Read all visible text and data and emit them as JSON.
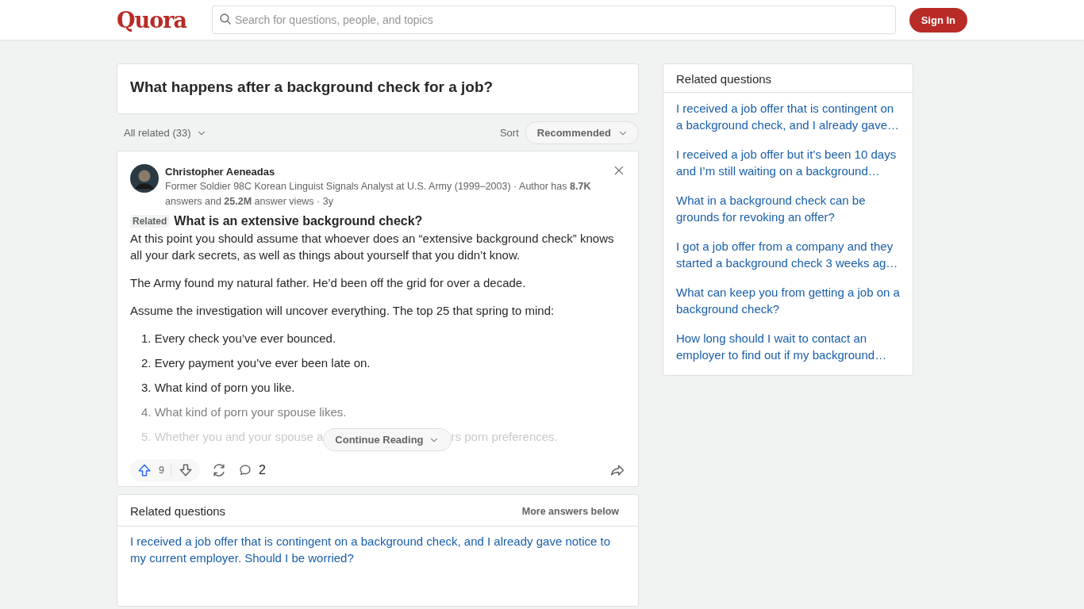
{
  "header": {
    "logo": "Quora",
    "search": {
      "placeholder": "Search for questions, people, and topics"
    },
    "sign_in": "Sign In"
  },
  "question": {
    "title": "What happens after a background check for a job?"
  },
  "filter": {
    "all_related": "All related (33)",
    "sort_label": "Sort",
    "sort_value": "Recommended"
  },
  "answer": {
    "author": "Christopher Aeneadas",
    "credential": "Former Soldier 98C Korean Linguist Signals Analyst at U.S. Army (1999–2003) · Author has **8.7K** answers and **25.2M** answer views · 3y",
    "related_tag": "Related",
    "related_question": "What is an extensive background check?",
    "paragraphs": [
      "At this point you should assume that whoever does an “extensive background check” knows all your dark secrets, as well as things about yourself that you didn’t know.",
      "The Army found my natural father. He’d been off the grid for over a decade.",
      "Assume the investigation will uncover everything. The top 25 that spring to mind:"
    ],
    "list": [
      "1. Every check you’ve ever bounced.",
      "2. Every payment you’ve ever been late on.",
      "3. What kind of porn you like.",
      "4. What kind of porn your spouse likes."
    ],
    "covered_item": {
      "before": "5. Whether you and your spouse a",
      "after": "rs porn preferences."
    },
    "continue_reading": "Continue Reading",
    "upvotes": "9",
    "comments": "2"
  },
  "related_main": {
    "title": "Related questions",
    "more": "More answers below",
    "items": [
      "I received a job offer that is contingent on a background check, and I already gave notice to my current employer. Should I be worried?"
    ]
  },
  "sidebar": {
    "title": "Related questions",
    "items": [
      "I received a job offer that is contingent on a background check, and I already gave…",
      "I received a job offer but it’s been 10 days and I’m still waiting on a background…",
      "What in a background check can be grounds for revoking an offer?",
      "I got a job offer from a company and they started a background check 3 weeks ag…",
      "What can keep you from getting a job on a background check?",
      "How long should I wait to contact an employer to find out if my background…"
    ]
  }
}
